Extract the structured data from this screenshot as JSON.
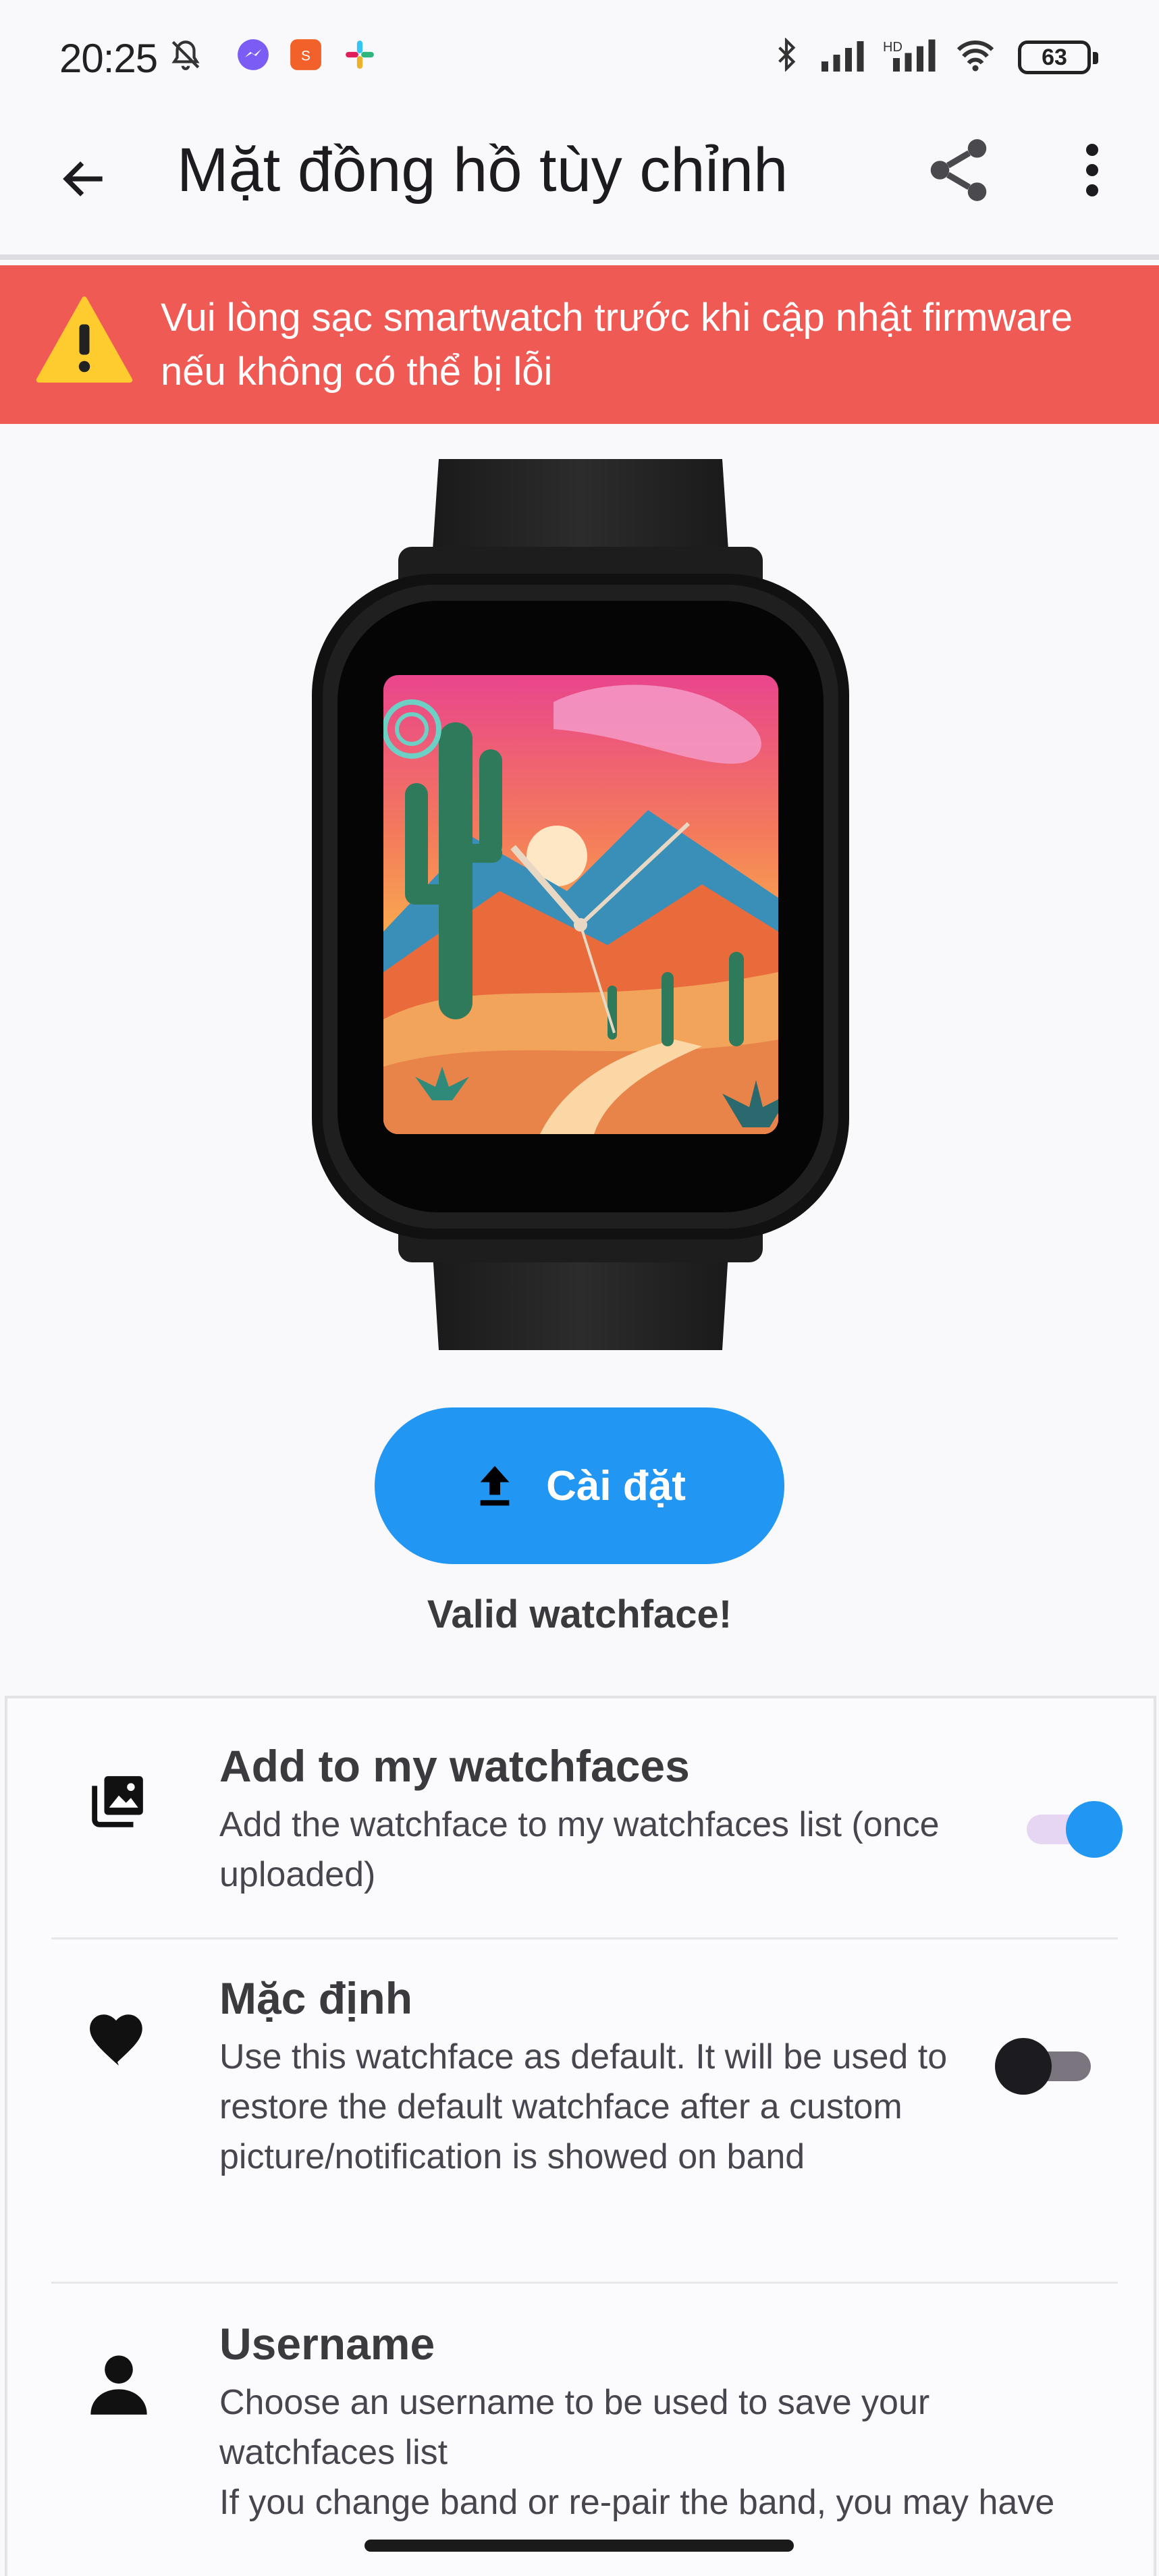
{
  "status_bar": {
    "time": "20:25",
    "battery": "63",
    "icons": [
      "bell-off-icon",
      "messenger-icon",
      "shopee-icon",
      "slack-icon",
      "bluetooth-icon",
      "signal-icon",
      "signal-hd-icon",
      "wifi-icon"
    ]
  },
  "app_bar": {
    "title": "Mặt đồng hồ tùy chỉnh",
    "back_icon": "arrow-back-icon",
    "share_icon": "share-icon",
    "more_icon": "more-vert-icon"
  },
  "warning": {
    "text": "Vui lòng sạc smartwatch trước khi cập nhật firmware nếu không có thể bị lỗi",
    "icon": "warning-triangle-icon",
    "color": "#f05a55"
  },
  "install": {
    "label": "Cài đặt",
    "icon": "upload-icon",
    "color": "#2196f3"
  },
  "status_message": "Valid watchface!",
  "settings": [
    {
      "title": "Add to my watchfaces",
      "description": "Add the watchface to my watchfaces list (once uploaded)",
      "icon": "photo-library-icon",
      "enabled": true
    },
    {
      "title": "Mặc định",
      "description": "Use this watchface as default. It will be used to restore the default watchface after a custom picture/notification is showed on band",
      "icon": "heart-icon",
      "enabled": false
    },
    {
      "title": "Username",
      "description": "Choose an username to be used to save your watchfaces list",
      "description_cont": "If you change band or re-pair the band, you may have",
      "icon": "person-icon"
    }
  ]
}
